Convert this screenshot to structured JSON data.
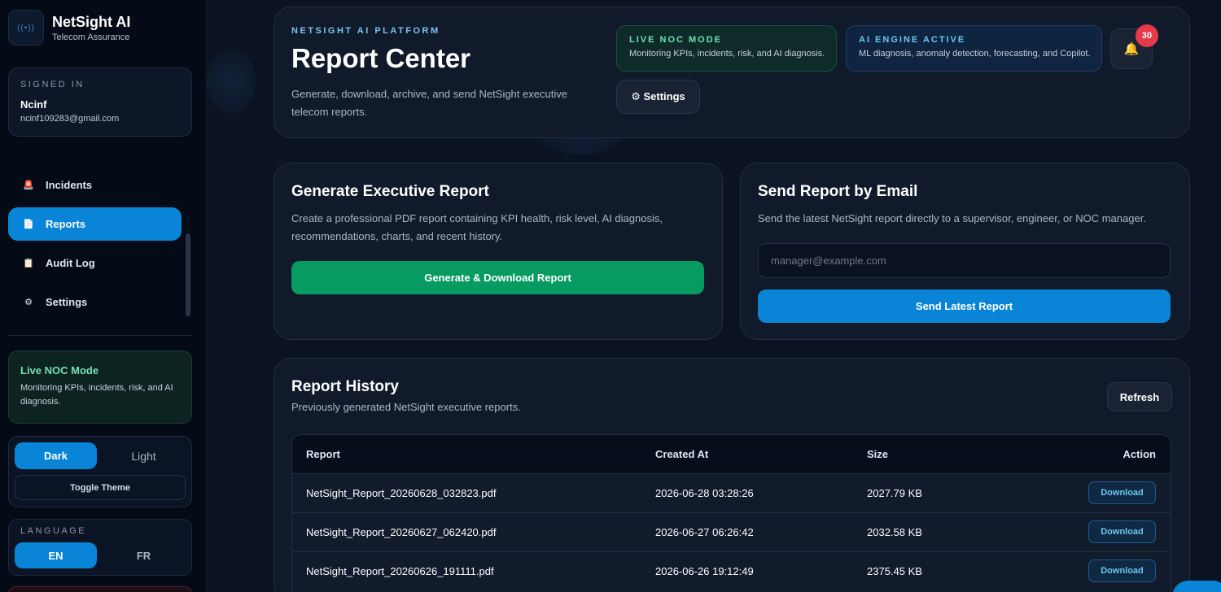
{
  "brand": {
    "name": "NetSight AI",
    "subtitle": "Telecom Assurance",
    "logo_icon": "network-wave-icon"
  },
  "signed_in": {
    "title": "SIGNED IN",
    "name": "Ncinf",
    "email": "ncinf109283@gmail.com"
  },
  "nav": {
    "items": [
      {
        "label": "Incidents",
        "icon": "siren-icon",
        "glyph": "🚨",
        "active": false
      },
      {
        "label": "Reports",
        "icon": "document-icon",
        "glyph": "📄",
        "active": true
      },
      {
        "label": "Audit Log",
        "icon": "clipboard-icon",
        "glyph": "📋",
        "active": false
      },
      {
        "label": "Settings",
        "icon": "gear-icon",
        "glyph": "⚙",
        "active": false
      }
    ]
  },
  "sidebar_noc": {
    "title": "Live NOC Mode",
    "desc": "Monitoring KPIs, incidents, risk, and AI diagnosis."
  },
  "theme": {
    "dark": "Dark",
    "light": "Light",
    "toggle": "Toggle Theme",
    "selected": "Dark"
  },
  "language": {
    "title": "LANGUAGE",
    "en": "EN",
    "fr": "FR",
    "selected": "EN"
  },
  "hero": {
    "eyebrow": "NETSIGHT AI PLATFORM",
    "title": "Report Center",
    "desc": "Generate, download, archive, and send NetSight executive telecom reports.",
    "live_noc": {
      "title": "LIVE NOC MODE",
      "desc": "Monitoring KPIs, incidents, risk, and AI diagnosis."
    },
    "ai_engine": {
      "title": "AI ENGINE ACTIVE",
      "desc": "ML diagnosis, anomaly detection, forecasting, and Copilot."
    },
    "notification_count": "30",
    "settings_label": "⚙ Settings"
  },
  "generate": {
    "title": "Generate Executive Report",
    "desc": "Create a professional PDF report containing KPI health, risk level, AI diagnosis, recommendations, charts, and recent history.",
    "button": "Generate & Download Report"
  },
  "email": {
    "title": "Send Report by Email",
    "desc": "Send the latest NetSight report directly to a supervisor, engineer, or NOC manager.",
    "placeholder": "manager@example.com",
    "value": "",
    "button": "Send Latest Report"
  },
  "history": {
    "title": "Report History",
    "subtitle": "Previously generated NetSight executive reports.",
    "refresh": "Refresh",
    "columns": [
      "Report",
      "Created At",
      "Size",
      "Action"
    ],
    "rows": [
      {
        "report": "NetSight_Report_20260628_032823.pdf",
        "created": "2026-06-28 03:28:26",
        "size": "2027.79 KB",
        "action": "Download"
      },
      {
        "report": "NetSight_Report_20260627_062420.pdf",
        "created": "2026-06-27 06:26:42",
        "size": "2032.58 KB",
        "action": "Download"
      },
      {
        "report": "NetSight_Report_20260626_191111.pdf",
        "created": "2026-06-26 19:12:49",
        "size": "2375.45 KB",
        "action": "Download"
      }
    ]
  },
  "colors": {
    "accent": "#0a84d6",
    "success": "#079b62",
    "danger": "#e53a4a",
    "background": "#0b1322"
  }
}
